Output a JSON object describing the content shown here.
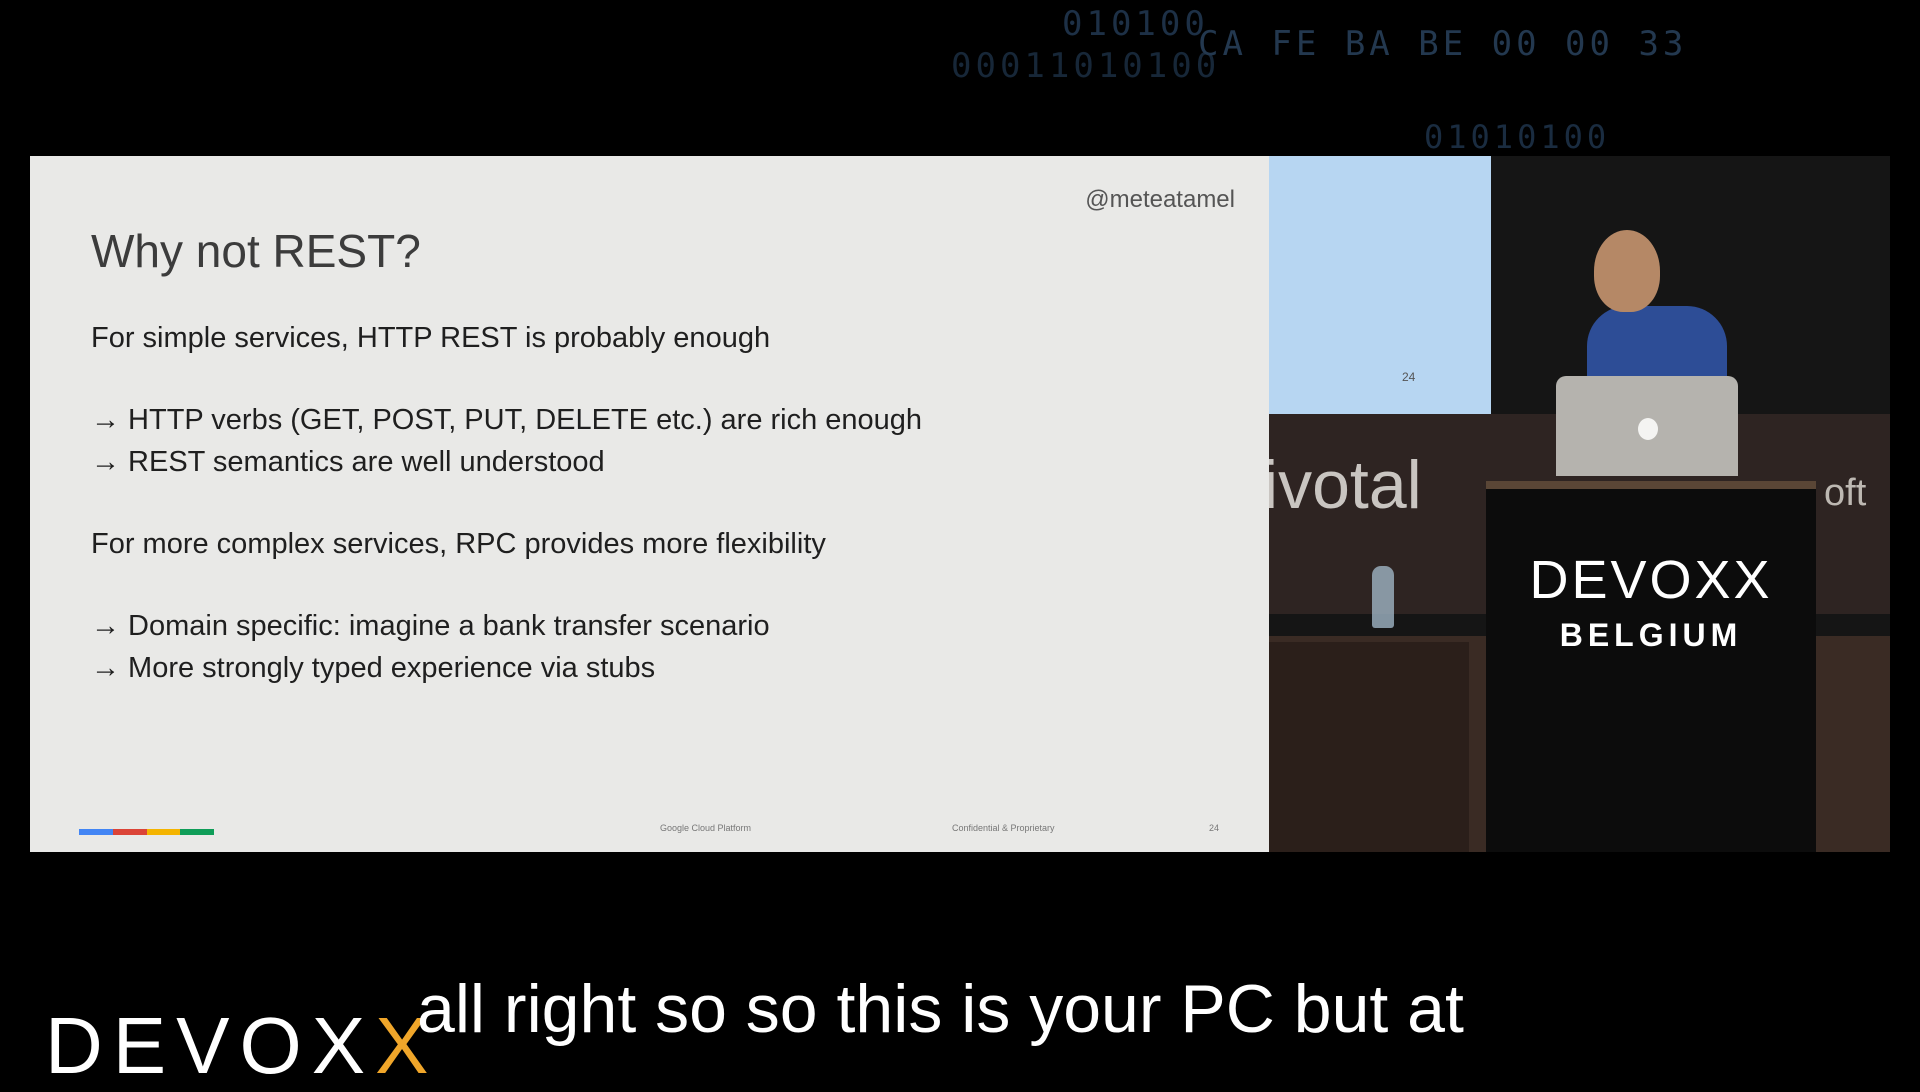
{
  "background_code": {
    "line1": "010100",
    "line2": "00011010100",
    "hex": "CA FE BA BE 00 00 33",
    "line3": "01010100"
  },
  "slide": {
    "handle": "@meteatamel",
    "title": "Why not REST?",
    "body": [
      "For simple services, HTTP REST is probably enough",
      "→ HTTP verbs (GET, POST, PUT, DELETE etc.) are rich enough",
      "→ REST semantics are well understood",
      "For more complex services, RPC provides more flexibility",
      "→ Domain specific: imagine a bank transfer scenario",
      "→ More strongly typed experience via stubs"
    ],
    "footer": {
      "platform": "Google Cloud Platform",
      "confidential": "Confidential & Proprietary",
      "page": "24"
    },
    "accent_colors": [
      "#4285f4",
      "#db4437",
      "#f4b400",
      "#0f9d58"
    ]
  },
  "video": {
    "screen_page": "24",
    "banner_text": "ivotal",
    "banner_text_right": "oft",
    "podium_logo": "DEVOXX",
    "podium_subtitle": "BELGIUM"
  },
  "watermark": {
    "logo_main": "DEVOX",
    "logo_accent": "X",
    "accent_color": "#f0a62a"
  },
  "subtitle": "all right so so this is your PC but at"
}
